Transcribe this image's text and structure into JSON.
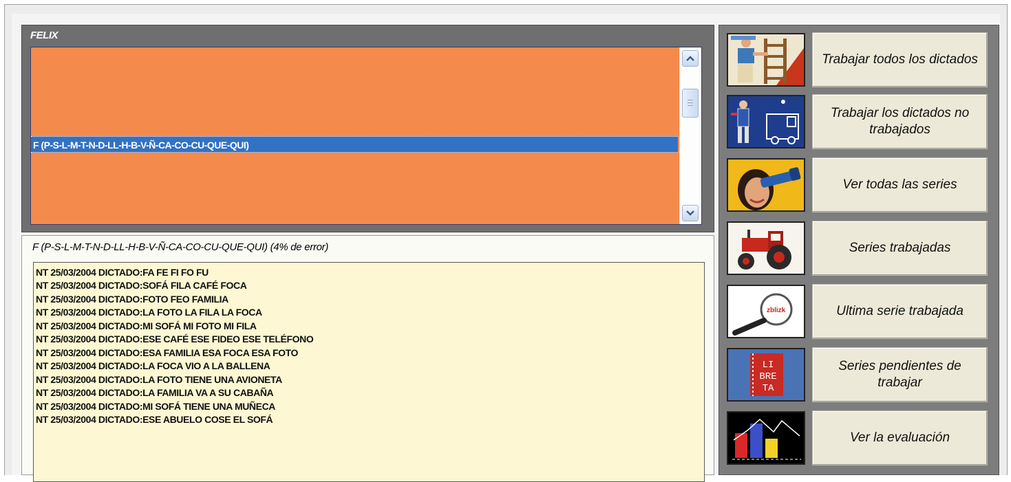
{
  "student": {
    "name": "FELIX"
  },
  "series_list": {
    "selected": "F (P-S-L-M-T-N-D-LL-H-B-V-Ñ-CA-CO-CU-QUE-QUI)"
  },
  "detail": {
    "title": "F (P-S-L-M-T-N-D-LL-H-B-V-Ñ-CA-CO-CU-QUE-QUI) (4% de error)",
    "lines": [
      "NT 25/03/2004 DICTADO:FA FE FI FO FU",
      "NT 25/03/2004 DICTADO:SOFÁ FILA CAFÉ FOCA",
      "NT 25/03/2004 DICTADO:FOTO FEO FAMILIA",
      "NT 25/03/2004 DICTADO:LA FOTO LA FILA LA FOCA",
      "NT 25/03/2004 DICTADO:MI SOFÁ MI FOTO MI FILA",
      "NT 25/03/2004 DICTADO:ESE CAFÉ ESE FIDEO ESE TELÉFONO",
      "NT 25/03/2004 DICTADO:ESA FAMILIA ESA FOCA ESA FOTO",
      "NT 25/03/2004 DICTADO:LA FOCA VIO A LA BALLENA",
      "NT 25/03/2004 DICTADO:LA FOTO TIENE UNA AVIONETA",
      "NT 25/03/2004 DICTADO:LA FAMILIA VA A SU CABAÑA",
      "NT 25/03/2004 DICTADO:MI SOFÁ TIENE UNA MUÑECA",
      "NT 25/03/2004 DICTADO:ESE ABUELO COSE EL SOFÁ"
    ]
  },
  "menu": [
    {
      "label": "Trabajar todos los dictados",
      "icon": "painter-ladder-icon"
    },
    {
      "label": "Trabajar los dictados no trabajados",
      "icon": "truck-man-icon"
    },
    {
      "label": "Ver todas las series",
      "icon": "girl-telescope-icon"
    },
    {
      "label": "Series trabajadas",
      "icon": "tractor-icon"
    },
    {
      "label": "Ultima serie trabajada",
      "icon": "magnifier-icon",
      "icon_text": "zblizk"
    },
    {
      "label": "Series pendientes de trabajar",
      "icon": "notebook-icon",
      "icon_text": [
        "LI",
        "BRE",
        "TA"
      ]
    },
    {
      "label": "Ver la evaluación",
      "icon": "bar-chart-icon"
    }
  ],
  "colors": {
    "list_bg": "#f58a4d",
    "selection": "#3272c4",
    "log_bg": "#fdf8d3",
    "menu_bg": "#7d7d7d",
    "button_bg": "#ece9d8"
  }
}
